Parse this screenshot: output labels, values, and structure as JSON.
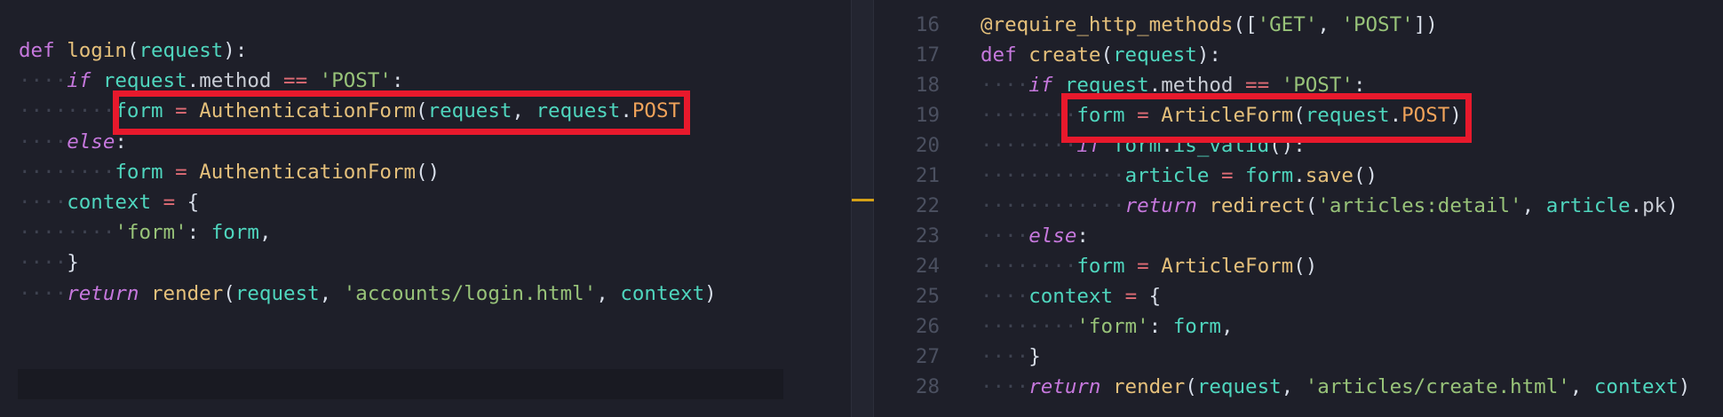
{
  "left_editor": {
    "lines": [
      {
        "indent": 0,
        "tokens": [
          {
            "c": "kw",
            "t": "def"
          },
          {
            "c": "punc",
            "t": " "
          },
          {
            "c": "fn",
            "t": "login"
          },
          {
            "c": "punc",
            "t": "("
          },
          {
            "c": "var",
            "t": "request"
          },
          {
            "c": "punc",
            "t": "):"
          }
        ]
      },
      {
        "indent": 1,
        "tokens": [
          {
            "c": "kwi",
            "t": "if"
          },
          {
            "c": "punc",
            "t": " "
          },
          {
            "c": "var",
            "t": "request"
          },
          {
            "c": "punc",
            "t": "."
          },
          {
            "c": "attr",
            "t": "method"
          },
          {
            "c": "punc",
            "t": " "
          },
          {
            "c": "op",
            "t": "=="
          },
          {
            "c": "punc",
            "t": " "
          },
          {
            "c": "str",
            "t": "'POST'"
          },
          {
            "c": "punc",
            "t": ":"
          }
        ]
      },
      {
        "indent": 2,
        "tokens": [
          {
            "c": "var",
            "t": "form"
          },
          {
            "c": "punc",
            "t": " "
          },
          {
            "c": "op",
            "t": "="
          },
          {
            "c": "punc",
            "t": " "
          },
          {
            "c": "cls",
            "t": "AuthenticationForm"
          },
          {
            "c": "punc",
            "t": "("
          },
          {
            "c": "var",
            "t": "request"
          },
          {
            "c": "punc",
            "t": ", "
          },
          {
            "c": "var",
            "t": "request"
          },
          {
            "c": "punc",
            "t": "."
          },
          {
            "c": "orange",
            "t": "POST"
          },
          {
            "c": "punc",
            "t": ")"
          }
        ]
      },
      {
        "indent": 1,
        "tokens": [
          {
            "c": "kwi",
            "t": "else"
          },
          {
            "c": "punc",
            "t": ":"
          }
        ]
      },
      {
        "indent": 2,
        "tokens": [
          {
            "c": "var",
            "t": "form"
          },
          {
            "c": "punc",
            "t": " "
          },
          {
            "c": "op",
            "t": "="
          },
          {
            "c": "punc",
            "t": " "
          },
          {
            "c": "cls",
            "t": "AuthenticationForm"
          },
          {
            "c": "punc",
            "t": "()"
          }
        ]
      },
      {
        "indent": 1,
        "tokens": [
          {
            "c": "var",
            "t": "context"
          },
          {
            "c": "punc",
            "t": " "
          },
          {
            "c": "op",
            "t": "="
          },
          {
            "c": "punc",
            "t": " {"
          }
        ]
      },
      {
        "indent": 2,
        "tokens": [
          {
            "c": "str",
            "t": "'form'"
          },
          {
            "c": "punc",
            "t": ": "
          },
          {
            "c": "var",
            "t": "form"
          },
          {
            "c": "punc",
            "t": ","
          }
        ]
      },
      {
        "indent": 1,
        "tokens": [
          {
            "c": "punc",
            "t": "}"
          }
        ]
      },
      {
        "indent": 1,
        "tokens": [
          {
            "c": "kwi",
            "t": "return"
          },
          {
            "c": "punc",
            "t": " "
          },
          {
            "c": "fn",
            "t": "render"
          },
          {
            "c": "punc",
            "t": "("
          },
          {
            "c": "var",
            "t": "request"
          },
          {
            "c": "punc",
            "t": ", "
          },
          {
            "c": "str",
            "t": "'accounts/login.html'"
          },
          {
            "c": "punc",
            "t": ", "
          },
          {
            "c": "var",
            "t": "context"
          },
          {
            "c": "punc",
            "t": ")"
          }
        ]
      }
    ]
  },
  "right_editor": {
    "lines": [
      {
        "num": "16",
        "indent": 0,
        "tokens": [
          {
            "c": "deco",
            "t": "@require_http_methods"
          },
          {
            "c": "punc",
            "t": "(["
          },
          {
            "c": "str",
            "t": "'GET'"
          },
          {
            "c": "punc",
            "t": ", "
          },
          {
            "c": "str",
            "t": "'POST'"
          },
          {
            "c": "punc",
            "t": "])"
          }
        ]
      },
      {
        "num": "17",
        "indent": 0,
        "tokens": [
          {
            "c": "kw",
            "t": "def"
          },
          {
            "c": "punc",
            "t": " "
          },
          {
            "c": "fn",
            "t": "create"
          },
          {
            "c": "punc",
            "t": "("
          },
          {
            "c": "var",
            "t": "request"
          },
          {
            "c": "punc",
            "t": "):"
          }
        ]
      },
      {
        "num": "18",
        "indent": 1,
        "tokens": [
          {
            "c": "kwi",
            "t": "if"
          },
          {
            "c": "punc",
            "t": " "
          },
          {
            "c": "var",
            "t": "request"
          },
          {
            "c": "punc",
            "t": "."
          },
          {
            "c": "attr",
            "t": "method"
          },
          {
            "c": "punc",
            "t": " "
          },
          {
            "c": "op",
            "t": "=="
          },
          {
            "c": "punc",
            "t": " "
          },
          {
            "c": "str",
            "t": "'POST'"
          },
          {
            "c": "punc",
            "t": ":"
          }
        ]
      },
      {
        "num": "19",
        "indent": 2,
        "tokens": [
          {
            "c": "var",
            "t": "form"
          },
          {
            "c": "punc",
            "t": " "
          },
          {
            "c": "op",
            "t": "="
          },
          {
            "c": "punc",
            "t": " "
          },
          {
            "c": "cls",
            "t": "ArticleForm"
          },
          {
            "c": "punc",
            "t": "("
          },
          {
            "c": "var",
            "t": "request"
          },
          {
            "c": "punc",
            "t": "."
          },
          {
            "c": "orange",
            "t": "POST"
          },
          {
            "c": "punc",
            "t": ")"
          }
        ]
      },
      {
        "num": "20",
        "indent": 2,
        "tokens": [
          {
            "c": "kwi",
            "t": "if"
          },
          {
            "c": "punc",
            "t": " "
          },
          {
            "c": "var",
            "t": "form"
          },
          {
            "c": "punc",
            "t": "."
          },
          {
            "c": "var",
            "t": "is_valid"
          },
          {
            "c": "punc",
            "t": "():"
          }
        ]
      },
      {
        "num": "21",
        "indent": 3,
        "tokens": [
          {
            "c": "var",
            "t": "article"
          },
          {
            "c": "punc",
            "t": " "
          },
          {
            "c": "op",
            "t": "="
          },
          {
            "c": "punc",
            "t": " "
          },
          {
            "c": "var",
            "t": "form"
          },
          {
            "c": "punc",
            "t": "."
          },
          {
            "c": "fn",
            "t": "save"
          },
          {
            "c": "punc",
            "t": "()"
          }
        ]
      },
      {
        "num": "22",
        "indent": 3,
        "tokens": [
          {
            "c": "kwi",
            "t": "return"
          },
          {
            "c": "punc",
            "t": " "
          },
          {
            "c": "fn",
            "t": "redirect"
          },
          {
            "c": "punc",
            "t": "("
          },
          {
            "c": "str",
            "t": "'articles:detail'"
          },
          {
            "c": "punc",
            "t": ", "
          },
          {
            "c": "var",
            "t": "article"
          },
          {
            "c": "punc",
            "t": "."
          },
          {
            "c": "attr",
            "t": "pk"
          },
          {
            "c": "punc",
            "t": ")"
          }
        ]
      },
      {
        "num": "23",
        "indent": 1,
        "tokens": [
          {
            "c": "kwi",
            "t": "else"
          },
          {
            "c": "punc",
            "t": ":"
          }
        ]
      },
      {
        "num": "24",
        "indent": 2,
        "tokens": [
          {
            "c": "var",
            "t": "form"
          },
          {
            "c": "punc",
            "t": " "
          },
          {
            "c": "op",
            "t": "="
          },
          {
            "c": "punc",
            "t": " "
          },
          {
            "c": "cls",
            "t": "ArticleForm"
          },
          {
            "c": "punc",
            "t": "()"
          }
        ]
      },
      {
        "num": "25",
        "indent": 1,
        "tokens": [
          {
            "c": "var",
            "t": "context"
          },
          {
            "c": "punc",
            "t": " "
          },
          {
            "c": "op",
            "t": "="
          },
          {
            "c": "punc",
            "t": " {"
          }
        ]
      },
      {
        "num": "26",
        "indent": 2,
        "tokens": [
          {
            "c": "str",
            "t": "'form'"
          },
          {
            "c": "punc",
            "t": ": "
          },
          {
            "c": "var",
            "t": "form"
          },
          {
            "c": "punc",
            "t": ","
          }
        ]
      },
      {
        "num": "27",
        "indent": 1,
        "tokens": [
          {
            "c": "punc",
            "t": "}"
          }
        ]
      },
      {
        "num": "28",
        "indent": 1,
        "tokens": [
          {
            "c": "kwi",
            "t": "return"
          },
          {
            "c": "punc",
            "t": " "
          },
          {
            "c": "fn",
            "t": "render"
          },
          {
            "c": "punc",
            "t": "("
          },
          {
            "c": "var",
            "t": "request"
          },
          {
            "c": "punc",
            "t": ", "
          },
          {
            "c": "str",
            "t": "'articles/create.html'"
          },
          {
            "c": "punc",
            "t": ", "
          },
          {
            "c": "var",
            "t": "context"
          },
          {
            "c": "punc",
            "t": ")"
          }
        ]
      }
    ]
  },
  "colors": {
    "background": "#1e1f29",
    "highlight_box": "#e8192c",
    "scroll_marker": "#d4a017"
  }
}
